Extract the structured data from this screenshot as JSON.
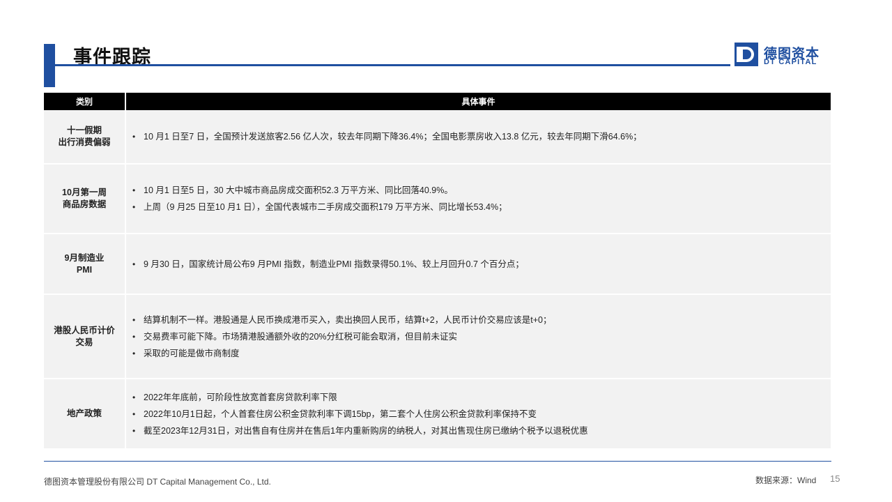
{
  "header": {
    "title": "事件跟踪",
    "logo_cn": "德图资本",
    "logo_en": "DT CAPITAL"
  },
  "table": {
    "col_category": "类别",
    "col_events": "具体事件",
    "rows": [
      {
        "category_line1": "十一假期",
        "category_line2": "出行消费偏弱",
        "items": [
          "10 月1 日至7 日，全国预计发送旅客2.56  亿人次，较去年同期下降36.4%；全国电影票房收入13.8  亿元，较去年同期下滑64.6%；"
        ]
      },
      {
        "category_line1": "10月第一周",
        "category_line2": "商品房数据",
        "items": [
          "10 月1 日至5 日，30 大中城市商品房成交面积52.3  万平方米、同比回落40.9%。",
          "上周（9 月25 日至10 月1 日），全国代表城市二手房成交面积179  万平方米、同比增长53.4%；"
        ]
      },
      {
        "category_line1": "9月制造业",
        "category_line2": "PMI",
        "items": [
          "9 月30 日，国家统计局公布9  月PMI 指数，制造业PMI  指数录得50.1%、较上月回升0.7  个百分点；"
        ]
      },
      {
        "category_line1": "港股人民币计价",
        "category_line2": "交易",
        "items": [
          "结算机制不一样。港股通是人民币换成港币买入，卖出换回人民币，结算t+2，人民币计价交易应该是t+0；",
          "交易费率可能下降。市场猜港股通额外收的20%分红税可能会取消，但目前未证实",
          "采取的可能是做市商制度"
        ]
      },
      {
        "category_line1": "地产政策",
        "category_line2": "",
        "items": [
          "2022年年底前，可阶段性放宽首套房贷款利率下限",
          "2022年10月1日起，个人首套住房公积金贷款利率下调15bp，第二套个人住房公积金贷款利率保持不变",
          "截至2023年12月31日，对出售自有住房并在售后1年内重新购房的纳税人，对其出售现住房已缴纳个税予以退税优惠"
        ]
      }
    ]
  },
  "footer": {
    "company": "德图资本管理股份有限公司  DT Capital  Management  Co., Ltd.",
    "source": "数据来源：Wind",
    "page_number": "15"
  },
  "colors": {
    "accent": "#1f4fa0",
    "header_bg": "#000000",
    "row_bg": "#f2f2f2"
  }
}
